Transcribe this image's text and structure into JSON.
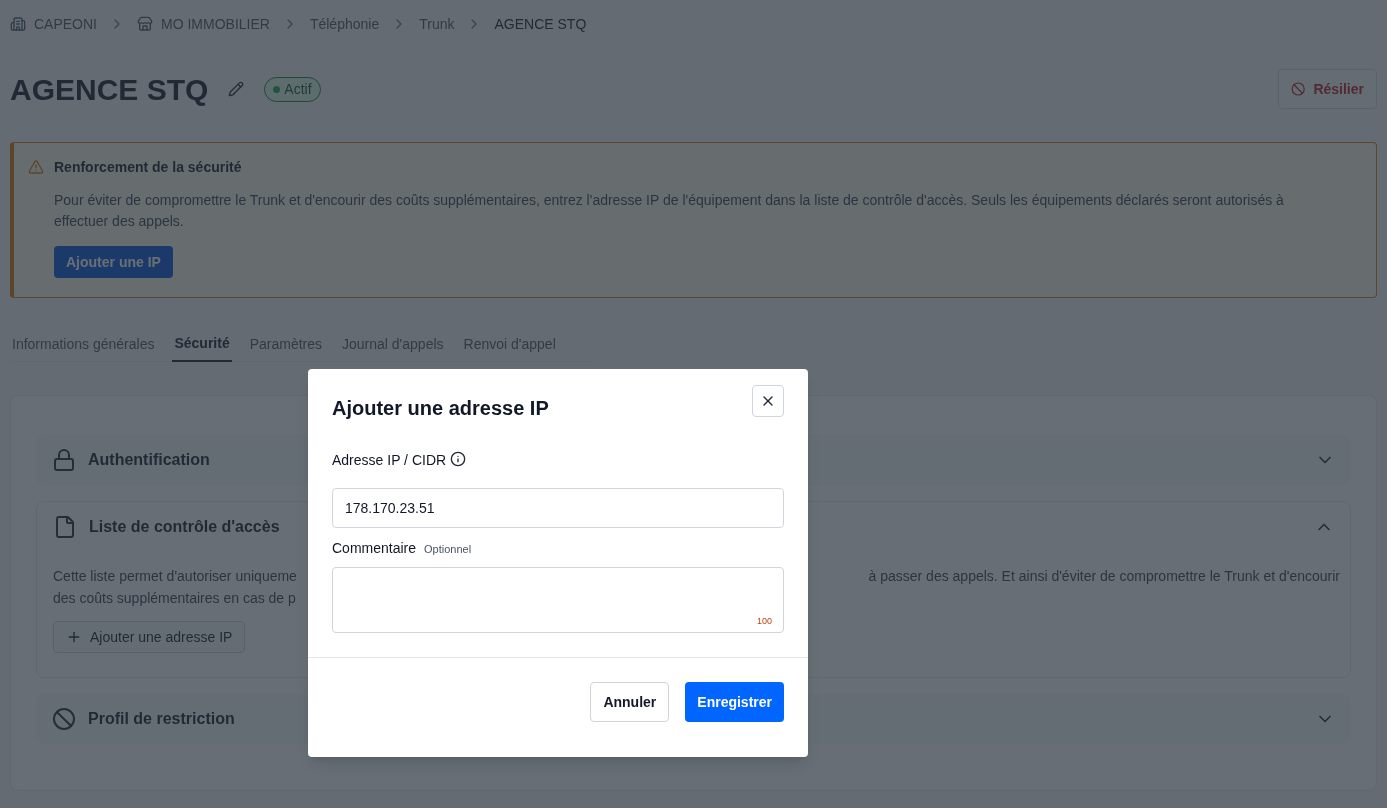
{
  "breadcrumb": [
    {
      "kind": "building",
      "label": "CAPEONI",
      "current": false
    },
    {
      "kind": "shop",
      "label": "MO IMMOBILIER",
      "current": false
    },
    {
      "kind": "text",
      "label": "Téléphonie",
      "current": false
    },
    {
      "kind": "text",
      "label": "Trunk",
      "current": false
    },
    {
      "kind": "text",
      "label": "AGENCE STQ",
      "current": true
    }
  ],
  "header": {
    "title": "AGENCE STQ",
    "status": "Actif",
    "terminate_button": "Résilier"
  },
  "alert": {
    "title": "Renforcement de la sécurité",
    "text": "Pour éviter de compromettre le Trunk et d'encourir des coûts supplémentaires, entrez l'adresse IP de l'équipement dans la liste de contrôle d'accès. Seuls les équipements déclarés seront autorisés à effectuer des appels.",
    "button": "Ajouter une IP"
  },
  "tabs": [
    {
      "label": "Informations générales",
      "selected": false
    },
    {
      "label": "Sécurité",
      "selected": true
    },
    {
      "label": "Paramètres",
      "selected": false
    },
    {
      "label": "Journal d'appels",
      "selected": false
    },
    {
      "label": "Renvoi d'appel",
      "selected": false
    }
  ],
  "sections": [
    {
      "kind": "lock",
      "title": "Authentification",
      "expanded": false
    },
    {
      "kind": "file",
      "title": "Liste de contrôle d'accès",
      "expanded": true,
      "text_line_1_left": "Cette liste permet d'autoriser uniqueme",
      "text_line_1_right": "à passer des appels. Et ainsi d'éviter de compromettre le Trunk et d'encourir",
      "text_line_2_left": "des coûts supplémentaires en cas de p",
      "button": "Ajouter une adresse IP"
    },
    {
      "kind": "ban",
      "title": "Profil de restriction",
      "expanded": false
    }
  ],
  "modal": {
    "title": "Ajouter une adresse IP",
    "ip_label": "Adresse IP / CIDR",
    "ip_value": "178.170.23.51",
    "comment_label": "Commentaire",
    "comment_hint": "Optionnel",
    "comment_counter": "100",
    "cancel": "Annuler",
    "save": "Enregistrer"
  }
}
